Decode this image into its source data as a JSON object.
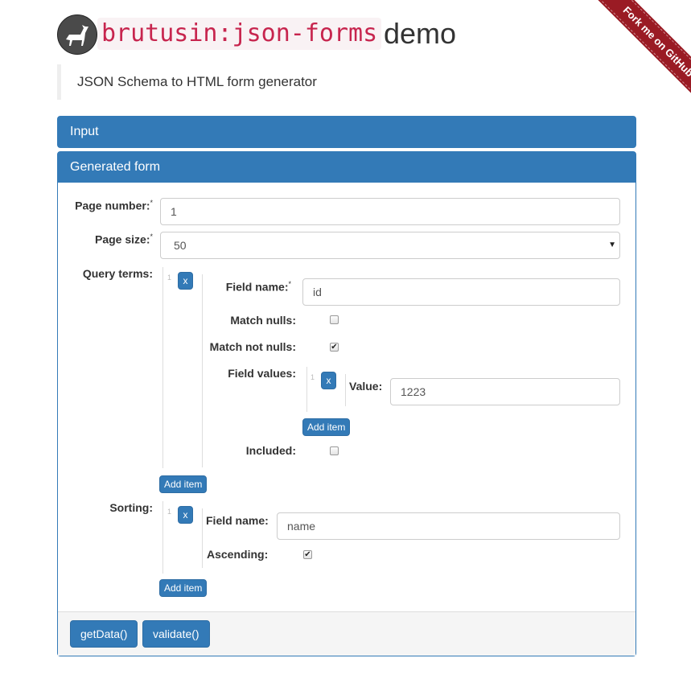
{
  "header": {
    "title_code": "brutusin:json-forms",
    "title_rest": "demo",
    "subtitle": "JSON Schema to HTML form generator",
    "logo_icon": "dog-logo-icon",
    "ribbon": "Fork me on GitHub"
  },
  "colors": {
    "primary": "#337ab7",
    "code": "#c7254e",
    "ribbon": "#9a1b24"
  },
  "panels": {
    "input": {
      "title": "Input"
    },
    "form": {
      "title": "Generated form"
    }
  },
  "form": {
    "page_number": {
      "label": "Page number:",
      "required": "*",
      "value": "1"
    },
    "page_size": {
      "label": "Page size:",
      "required": "*",
      "selected": "50"
    },
    "query_terms": {
      "label": "Query terms:",
      "items": [
        {
          "index": "1",
          "remove": "x",
          "field_name": {
            "label": "Field name:",
            "required": "*",
            "value": "id"
          },
          "match_nulls": {
            "label": "Match nulls:",
            "checked": false
          },
          "match_not_nulls": {
            "label": "Match not nulls:",
            "checked": true
          },
          "field_values": {
            "label": "Field values:",
            "items": [
              {
                "index": "1",
                "remove": "x",
                "label": "Value:",
                "value": "1223"
              }
            ],
            "add": "Add item"
          },
          "included": {
            "label": "Included:",
            "checked": false
          }
        }
      ],
      "add": "Add item"
    },
    "sorting": {
      "label": "Sorting:",
      "items": [
        {
          "index": "1",
          "remove": "x",
          "field_name": {
            "label": "Field name:",
            "value": "name"
          },
          "ascending": {
            "label": "Ascending:",
            "checked": true
          }
        }
      ],
      "add": "Add item"
    }
  },
  "footer": {
    "get_data": "getData()",
    "validate": "validate()"
  },
  "check_glyph": "✔"
}
